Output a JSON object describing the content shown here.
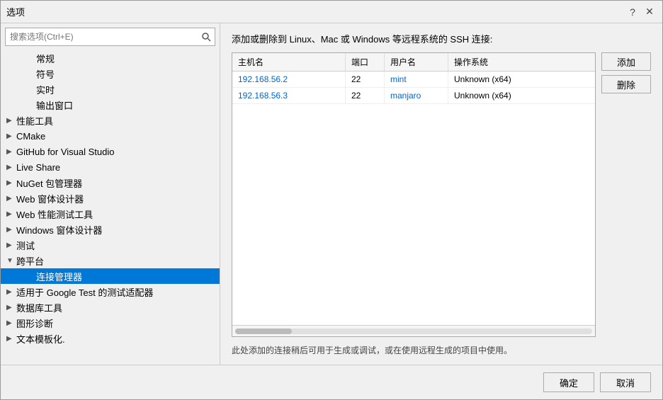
{
  "dialog": {
    "title": "选项",
    "help_btn": "?",
    "close_btn": "✕"
  },
  "search": {
    "placeholder": "搜索选项(Ctrl+E)"
  },
  "tree": {
    "items": [
      {
        "id": "general",
        "label": "常规",
        "indent": 1,
        "arrow": "",
        "selected": false
      },
      {
        "id": "symbol",
        "label": "符号",
        "indent": 1,
        "arrow": "",
        "selected": false
      },
      {
        "id": "realtime",
        "label": "实时",
        "indent": 1,
        "arrow": "",
        "selected": false
      },
      {
        "id": "output",
        "label": "输出窗口",
        "indent": 1,
        "arrow": "",
        "selected": false
      },
      {
        "id": "perf-tools",
        "label": "性能工具",
        "indent": 0,
        "arrow": "▶",
        "selected": false
      },
      {
        "id": "cmake",
        "label": "CMake",
        "indent": 0,
        "arrow": "▶",
        "selected": false
      },
      {
        "id": "github",
        "label": "GitHub for Visual Studio",
        "indent": 0,
        "arrow": "▶",
        "selected": false
      },
      {
        "id": "liveshare",
        "label": "Live Share",
        "indent": 0,
        "arrow": "▶",
        "selected": false
      },
      {
        "id": "nuget",
        "label": "NuGet 包管理器",
        "indent": 0,
        "arrow": "▶",
        "selected": false
      },
      {
        "id": "web-designer",
        "label": "Web 窗体设计器",
        "indent": 0,
        "arrow": "▶",
        "selected": false
      },
      {
        "id": "web-perf",
        "label": "Web 性能测试工具",
        "indent": 0,
        "arrow": "▶",
        "selected": false
      },
      {
        "id": "win-designer",
        "label": "Windows 窗体设计器",
        "indent": 0,
        "arrow": "▶",
        "selected": false
      },
      {
        "id": "test",
        "label": "测试",
        "indent": 0,
        "arrow": "▶",
        "selected": false
      },
      {
        "id": "crossplat",
        "label": "跨平台",
        "indent": 0,
        "arrow": "▼",
        "selected": false
      },
      {
        "id": "connection-manager",
        "label": "连接管理器",
        "indent": 1,
        "arrow": "",
        "selected": true
      },
      {
        "id": "google-test",
        "label": "适用于 Google Test 的测试适配器",
        "indent": 0,
        "arrow": "▶",
        "selected": false
      },
      {
        "id": "database",
        "label": "数据库工具",
        "indent": 0,
        "arrow": "▶",
        "selected": false
      },
      {
        "id": "graph-diag",
        "label": "图形诊断",
        "indent": 0,
        "arrow": "▶",
        "selected": false
      },
      {
        "id": "text-template",
        "label": "文本模板化.",
        "indent": 0,
        "arrow": "▶",
        "selected": false
      }
    ]
  },
  "right": {
    "title": "添加或删除到 Linux、Mac 或 Windows 等远程系统的 SSH 连接:",
    "table": {
      "headers": [
        "主机名",
        "端口",
        "用户名",
        "操作系统"
      ],
      "rows": [
        {
          "hostname": "192.168.56.2",
          "port": "22",
          "username": "mint",
          "os": "Unknown (x64)"
        },
        {
          "hostname": "192.168.56.3",
          "port": "22",
          "username": "manjaro",
          "os": "Unknown (x64)"
        }
      ]
    },
    "add_btn": "添加",
    "delete_btn": "删除",
    "desc": "此处添加的连接稍后可用于生成或调试，或在使用远程生成的项目中使用。"
  },
  "footer": {
    "ok_btn": "确定",
    "cancel_btn": "取消"
  }
}
